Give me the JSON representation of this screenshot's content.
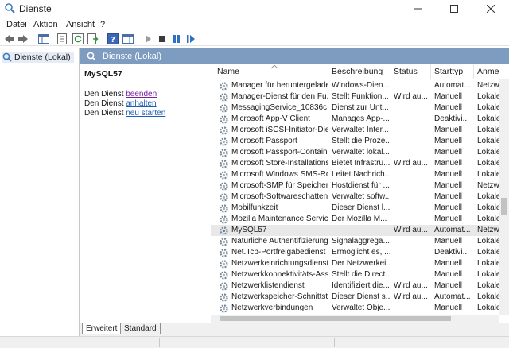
{
  "window": {
    "title": "Dienste"
  },
  "menu": [
    "Datei",
    "Aktion",
    "Ansicht",
    "?"
  ],
  "tree": {
    "root_label": "Dienste (Lokal)"
  },
  "main": {
    "header_title": "Dienste (Lokal)"
  },
  "detail": {
    "service_name": "MySQL57",
    "actions": [
      {
        "prefix": "Den Dienst",
        "link": "beenden"
      },
      {
        "prefix": "Den Dienst",
        "link": "anhalten"
      },
      {
        "prefix": "Den Dienst",
        "link": "neu starten"
      }
    ]
  },
  "columns": [
    "Name",
    "Beschreibung",
    "Status",
    "Starttyp",
    "Anme"
  ],
  "rows": [
    {
      "name": "Manager für heruntergelade...",
      "desc": "Windows-Dien...",
      "status": "",
      "start": "Automat...",
      "logon": "Netzw"
    },
    {
      "name": "Manager-Dienst für den Fu...",
      "desc": "Stellt Funktion...",
      "status": "Wird au...",
      "start": "Manuell",
      "logon": "Lokale"
    },
    {
      "name": "MessagingService_10836c",
      "desc": "Dienst zur Unt...",
      "status": "",
      "start": "Manuell",
      "logon": "Lokale"
    },
    {
      "name": "Microsoft App-V Client",
      "desc": "Manages App-...",
      "status": "",
      "start": "Deaktivi...",
      "logon": "Lokale"
    },
    {
      "name": "Microsoft iSCSI-Initiator-Die...",
      "desc": "Verwaltet Inter...",
      "status": "",
      "start": "Manuell",
      "logon": "Lokale"
    },
    {
      "name": "Microsoft Passport",
      "desc": "Stellt die Proze...",
      "status": "",
      "start": "Manuell",
      "logon": "Lokale"
    },
    {
      "name": "Microsoft Passport-Container",
      "desc": "Verwaltet lokal...",
      "status": "",
      "start": "Manuell",
      "logon": "Lokale"
    },
    {
      "name": "Microsoft Store-Installations...",
      "desc": "Bietet Infrastru...",
      "status": "Wird au...",
      "start": "Manuell",
      "logon": "Lokale"
    },
    {
      "name": "Microsoft Windows SMS-Ro...",
      "desc": "Leitet Nachrich...",
      "status": "",
      "start": "Manuell",
      "logon": "Lokale"
    },
    {
      "name": "Microsoft-SMP für Speicher...",
      "desc": "Hostdienst für ...",
      "status": "",
      "start": "Manuell",
      "logon": "Netzw"
    },
    {
      "name": "Microsoft-Softwareschatten...",
      "desc": "Verwaltet softw...",
      "status": "",
      "start": "Manuell",
      "logon": "Lokale"
    },
    {
      "name": "Mobilfunkzeit",
      "desc": "Dieser Dienst l...",
      "status": "",
      "start": "Manuell",
      "logon": "Lokale"
    },
    {
      "name": "Mozilla Maintenance Service",
      "desc": "Der Mozilla M...",
      "status": "",
      "start": "Manuell",
      "logon": "Lokale"
    },
    {
      "name": "MySQL57",
      "desc": "",
      "status": "Wird au...",
      "start": "Automat...",
      "logon": "Netzw",
      "selected": true
    },
    {
      "name": "Natürliche Authentifizierung",
      "desc": "Signalaggrega...",
      "status": "",
      "start": "Manuell",
      "logon": "Lokale"
    },
    {
      "name": "Net.Tcp-Portfreigabedienst",
      "desc": "Ermöglicht es, ...",
      "status": "",
      "start": "Deaktivi...",
      "logon": "Lokale"
    },
    {
      "name": "Netzwerkeinrichtungsdienst",
      "desc": "Der Netzwerkei...",
      "status": "",
      "start": "Manuell",
      "logon": "Lokale"
    },
    {
      "name": "Netzwerkkonnektivitäts-Assi...",
      "desc": "Stellt die Direct...",
      "status": "",
      "start": "Manuell",
      "logon": "Lokale"
    },
    {
      "name": "Netzwerklistendienst",
      "desc": "Identifiziert die...",
      "status": "Wird au...",
      "start": "Manuell",
      "logon": "Lokale"
    },
    {
      "name": "Netzwerkspeicher-Schnittste...",
      "desc": "Dieser Dienst s...",
      "status": "Wird au...",
      "start": "Automat...",
      "logon": "Lokale"
    },
    {
      "name": "Netzwerkverbindungen",
      "desc": "Verwaltet Obje...",
      "status": "",
      "start": "Manuell",
      "logon": "Lokale"
    }
  ],
  "tabs": [
    "Erweitert",
    "Standard"
  ],
  "colors": {
    "header_bg": "#7d9cc0",
    "link": "#1e5fb4",
    "visited_link": "#7a1fa2",
    "selected_row": "#e8e8e8"
  }
}
